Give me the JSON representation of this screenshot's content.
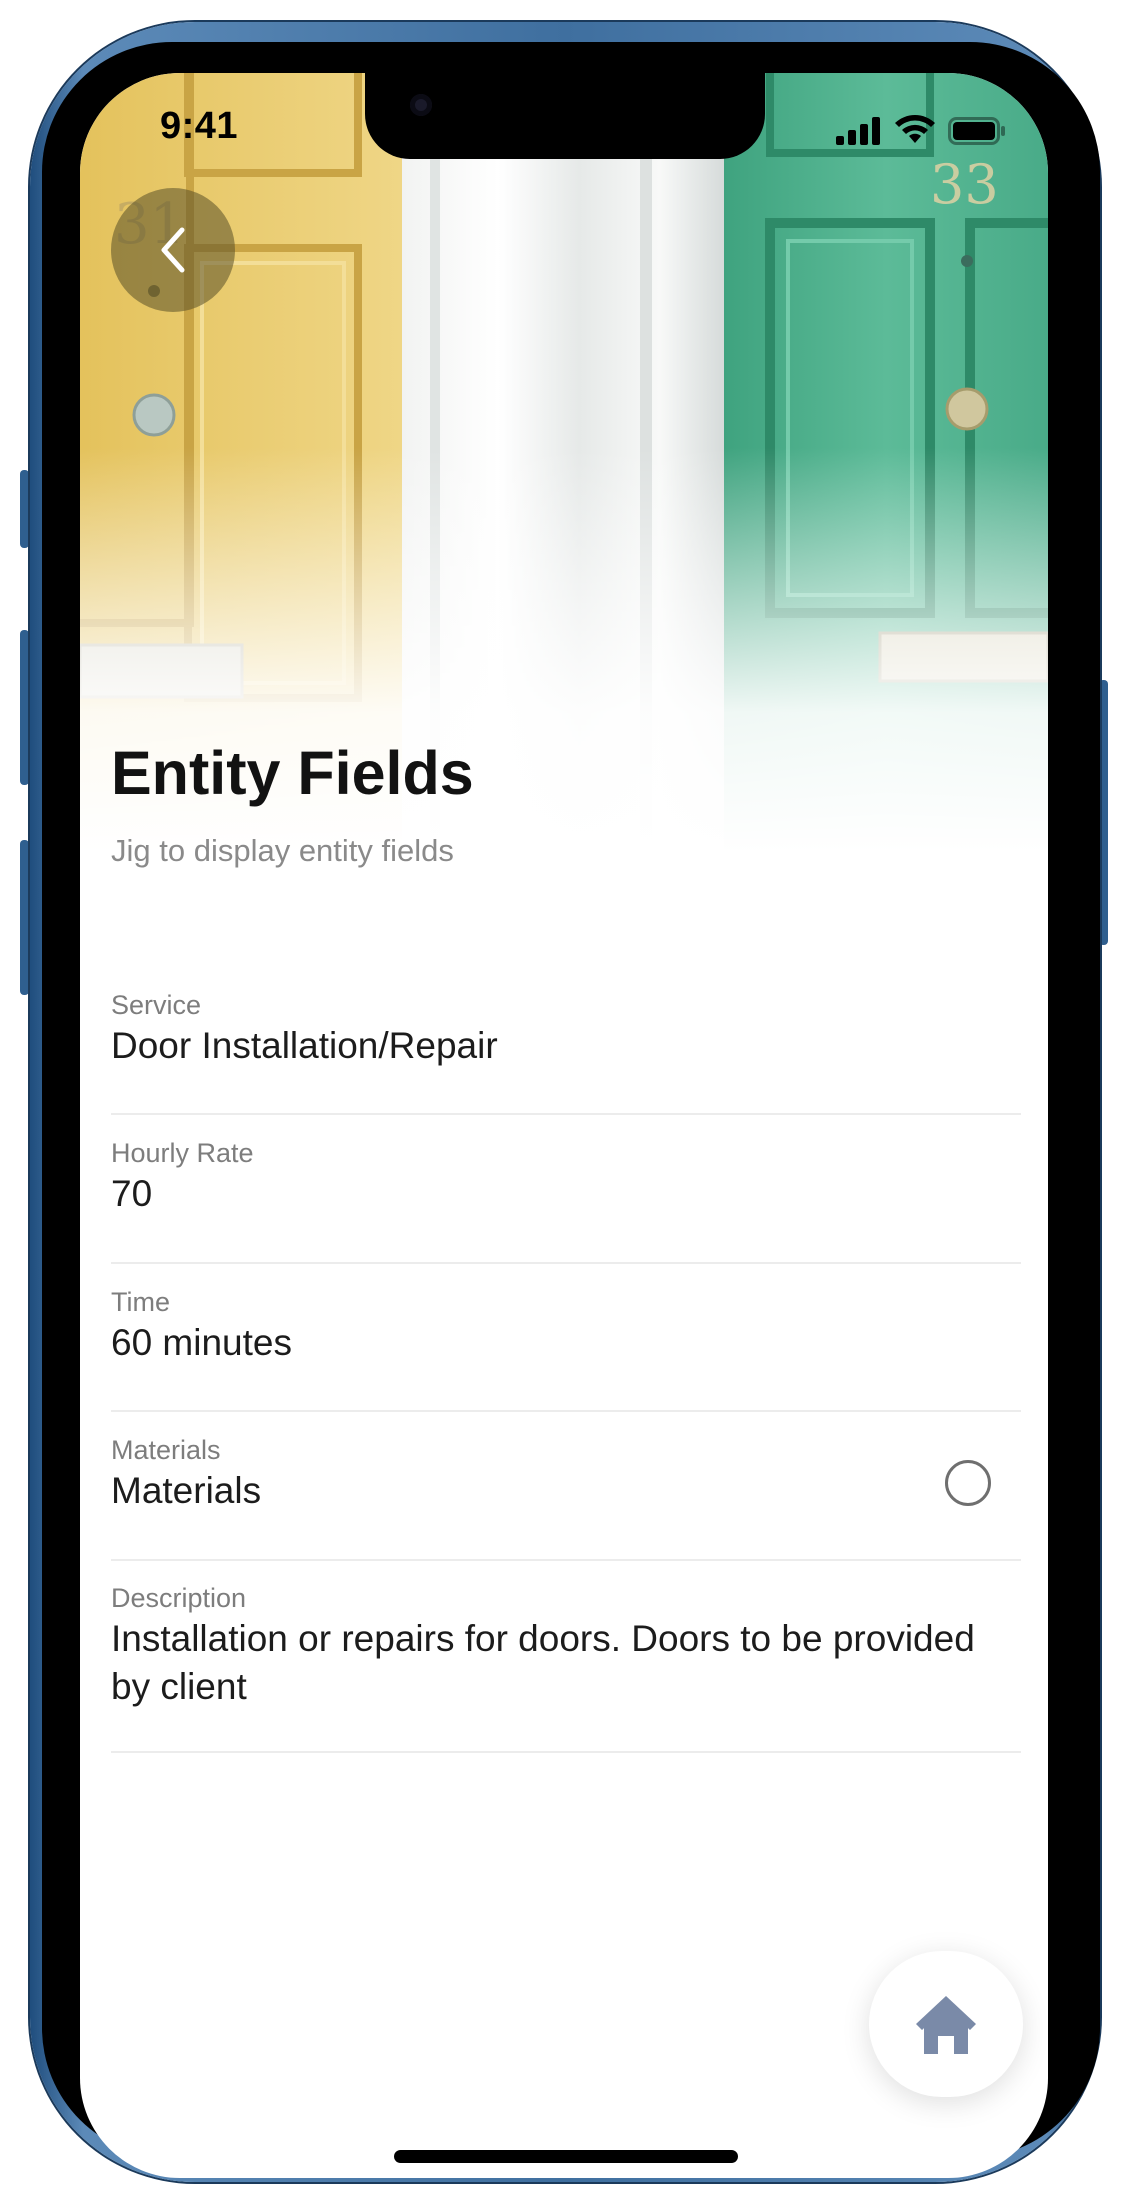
{
  "status_bar": {
    "time": "9:41"
  },
  "hero": {
    "door_left_number": "31",
    "door_right_number": "33"
  },
  "header": {
    "title": "Entity Fields",
    "subtitle": "Jig to display entity fields"
  },
  "fields": [
    {
      "label": "Service",
      "value": "Door Installation/Repair"
    },
    {
      "label": "Hourly Rate",
      "value": "70"
    },
    {
      "label": "Time",
      "value": "60 minutes"
    },
    {
      "label": "Materials",
      "value": "Materials",
      "checked": false
    },
    {
      "label": "Description",
      "value": "Installation or repairs for doors. Doors to be provided by client"
    }
  ],
  "icons": {
    "back": "chevron-left-icon",
    "home": "home-icon",
    "signal": "cellular-signal-icon",
    "wifi": "wifi-icon",
    "battery": "battery-icon"
  },
  "colors": {
    "frame": "#3f6f9f",
    "home_icon": "#7a8aa8",
    "door_left": "#e8c96a",
    "door_right": "#4fb08e"
  }
}
